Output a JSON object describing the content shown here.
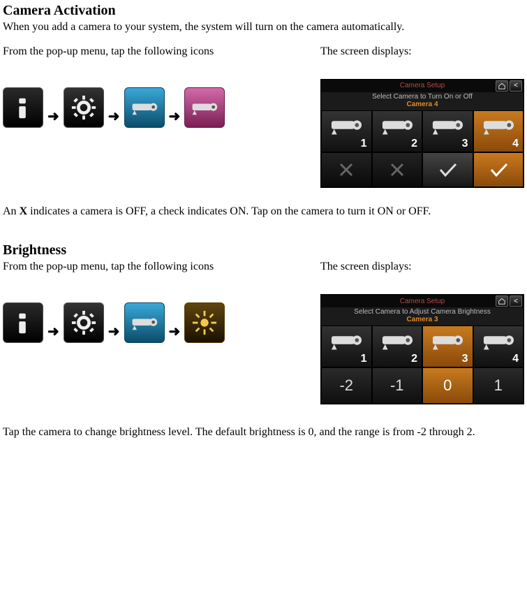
{
  "section1": {
    "heading": "Camera Activation",
    "intro": "When you add a camera to your system, the system will turn on the camera automatically.",
    "left_label": "From the pop-up menu, tap the following icons",
    "right_label": "The screen displays:",
    "after": "An X indicates a camera is OFF, a check indicates ON. Tap on the camera to turn it ON or OFF.",
    "screen": {
      "title": "Camera Setup",
      "sub": "Select Camera to Turn On or Off",
      "selected": "Camera 4",
      "cams": [
        "1",
        "2",
        "3",
        "4"
      ]
    }
  },
  "section2": {
    "heading": "Brightness",
    "left_label": "From the pop-up menu, tap the following icons",
    "right_label": "The screen displays:",
    "after": "Tap the camera to change brightness level. The default brightness is 0, and the range is from -2 through 2.",
    "screen": {
      "title": "Camera Setup",
      "sub": "Select Camera to Adjust Camera Brightness",
      "selected": "Camera 3",
      "cams": [
        "1",
        "2",
        "3",
        "4"
      ],
      "levels": [
        "-2",
        "-1",
        "0",
        "1"
      ]
    }
  },
  "arrow": "➜"
}
